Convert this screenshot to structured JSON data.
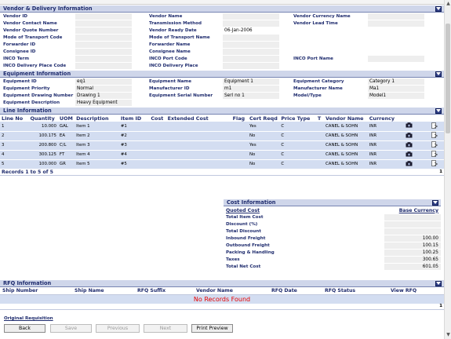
{
  "vendor": {
    "title": "Vendor & Delivery Information",
    "rows": [
      [
        {
          "label": "Vendor ID",
          "value": ""
        },
        {
          "label": "Vendor Name",
          "value": ""
        },
        {
          "label": "Vendor Currency Name",
          "value": ""
        }
      ],
      [
        {
          "label": "Vendor Contact Name",
          "value": ""
        },
        {
          "label": "Transmission Method",
          "value": ""
        },
        {
          "label": "Vendor Lead Time",
          "value": ""
        }
      ],
      [
        {
          "label": "Vendor Quote Number",
          "value": ""
        },
        {
          "label": "Vendor Ready Date",
          "value": "06-Jan-2006"
        },
        {
          "label": "",
          "value": ""
        }
      ],
      [
        {
          "label": "Mode of Transport Code",
          "value": ""
        },
        {
          "label": "Mode of Transport Name",
          "value": ""
        },
        {
          "label": "",
          "value": ""
        }
      ],
      [
        {
          "label": "Forwarder ID",
          "value": ""
        },
        {
          "label": "Forwarder Name",
          "value": ""
        },
        {
          "label": "",
          "value": ""
        }
      ],
      [
        {
          "label": "Consignee ID",
          "value": ""
        },
        {
          "label": "Consignee Name",
          "value": ""
        },
        {
          "label": "",
          "value": ""
        }
      ],
      [
        {
          "label": "INCO Term",
          "value": ""
        },
        {
          "label": "INCO Port Code",
          "value": ""
        },
        {
          "label": "INCO Port Name",
          "value": ""
        }
      ],
      [
        {
          "label": "INCO Delivery Place Code",
          "value": ""
        },
        {
          "label": "INCO Delivery Place",
          "value": ""
        },
        {
          "label": "",
          "value": ""
        }
      ]
    ]
  },
  "equipment": {
    "title": "Equipment Information",
    "rows": [
      [
        {
          "label": "Equipment ID",
          "value": "eq1"
        },
        {
          "label": "Equipment Name",
          "value": "Equipment 1"
        },
        {
          "label": "Equipment Category",
          "value": "Category 1"
        }
      ],
      [
        {
          "label": "Equipment Priority",
          "value": "Normal"
        },
        {
          "label": "Manufacturer ID",
          "value": "m1"
        },
        {
          "label": "Manufacturer Name",
          "value": "Ma1"
        }
      ],
      [
        {
          "label": "Equipment Drawing Number",
          "value": "Drawing 1"
        },
        {
          "label": "Equipment Serial Number",
          "value": "Serl no 1"
        },
        {
          "label": "Model/Type",
          "value": "Model1"
        }
      ],
      [
        {
          "label": "Equipment Description",
          "value": "Heavy Equipment"
        },
        {
          "label": "",
          "value": ""
        },
        {
          "label": "",
          "value": ""
        }
      ]
    ]
  },
  "lines": {
    "title": "Line Information",
    "headers": [
      "Line No",
      "Quantity",
      "UOM",
      "Description",
      "Item ID",
      "Cost",
      "Extended Cost",
      "Flag",
      "Cert Reqd",
      "Price Type",
      "T",
      "Vendor Name",
      "Currency"
    ],
    "rows": [
      [
        "1",
        "10.000",
        "GAL",
        "Item 1",
        "#1",
        "",
        "",
        "",
        "Yes",
        "C",
        "",
        "CANEL & SOHN",
        "INR"
      ],
      [
        "2",
        "100.175",
        "EA",
        "Item 2",
        "#2",
        "",
        "",
        "",
        "No",
        "C",
        "",
        "CANEL & SOHN",
        "INR"
      ],
      [
        "3",
        "200.800",
        "C/L",
        "Item 3",
        "#3",
        "",
        "",
        "",
        "Yes",
        "C",
        "",
        "CANEL & SOHN",
        "INR"
      ],
      [
        "4",
        "300.125",
        "FT",
        "Item 4",
        "#4",
        "",
        "",
        "",
        "No",
        "C",
        "",
        "CANEL & SOHN",
        "INR"
      ],
      [
        "5",
        "100.000",
        "GR",
        "Item 5",
        "#5",
        "",
        "",
        "",
        "No",
        "C",
        "",
        "CANEL & SOHN",
        "INR"
      ]
    ],
    "records_label": "Records 1 to 5 of 5",
    "page": "1"
  },
  "cost": {
    "title": "Cost Information",
    "quoted_cost_label": "Quoted Cost",
    "base_currency_label": "Base Currency",
    "rows": [
      {
        "label": "Total Item Cost",
        "value": ""
      },
      {
        "label": "Discount (%)",
        "value": ""
      },
      {
        "label": "Total Discount",
        "value": ""
      },
      {
        "label": "Inbound Freight",
        "value": "100.00"
      },
      {
        "label": "Outbound Freight",
        "value": "100.15"
      },
      {
        "label": "Packing & Handling",
        "value": "100.25"
      },
      {
        "label": "Taxes",
        "value": "300.65"
      },
      {
        "label": "Total Net Cost",
        "value": "601.05"
      }
    ]
  },
  "rfq": {
    "title": "RFQ Information",
    "headers": [
      "Ship Number",
      "Ship Name",
      "RFQ Suffix",
      "Vendor Name",
      "RFQ Date",
      "RFQ Status",
      "View RFQ"
    ],
    "no_records": "No Records Found",
    "page": "1"
  },
  "original_requisition_link": "Original Requisition",
  "buttons": {
    "back": "Back",
    "save": "Save",
    "previous": "Previous",
    "next": "Next",
    "print_preview": "Print Preview"
  },
  "colors": {
    "header_bg": "#cfd6ea",
    "label": "#1f2c6e",
    "row_bg": "#d3ddf1",
    "error": "#e60000"
  }
}
